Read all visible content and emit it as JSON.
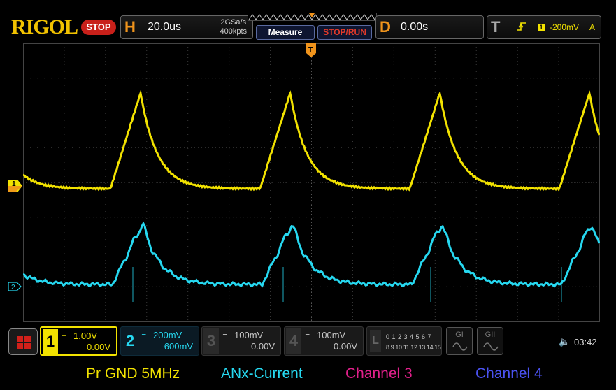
{
  "header": {
    "brand": "RIGOL",
    "run_state": "STOP",
    "horizontal": {
      "letter": "H",
      "timebase": "20.0us",
      "sample_rate": "2GSa/s",
      "memory_depth": "400kpts"
    },
    "measure_label": "Measure",
    "stop_run_label": "STOP/RUN",
    "delay": {
      "letter": "D",
      "value": "0.00s"
    },
    "trigger": {
      "letter": "T",
      "source": "1",
      "level": "-200mV",
      "mode": "A"
    }
  },
  "markers": {
    "ch1": "1",
    "ch2": "2",
    "trigger": "T"
  },
  "channels": [
    {
      "num": "1",
      "scale": "1.00V",
      "offset": "0.00V",
      "color": "#f2e200"
    },
    {
      "num": "2",
      "scale": "200mV",
      "offset": "-600mV",
      "color": "#26d8f0"
    },
    {
      "num": "3",
      "scale": "100mV",
      "offset": "0.00V",
      "color": "#c8c8c8"
    },
    {
      "num": "4",
      "scale": "100mV",
      "offset": "0.00V",
      "color": "#c8c8c8"
    }
  ],
  "logic": {
    "letter": "L",
    "row1": "0 1 2 3  4 5 6 7",
    "row2": "8 9 10 11 12 13 14 15"
  },
  "generators": [
    {
      "label": "GI"
    },
    {
      "label": "GII"
    }
  ],
  "speaker_icon": "speaker-muted-icon",
  "clock": "03:42",
  "legend": {
    "ch1": "Pr GND 5MHz",
    "ch2": "ANx-Current",
    "ch3": "Channel 3",
    "ch4": "Channel 4"
  },
  "colors": {
    "ch1": "#f2e200",
    "ch2": "#26d8f0",
    "ch3": "#e0208a",
    "ch4": "#4a52f0",
    "accent": "#f0941c"
  }
}
